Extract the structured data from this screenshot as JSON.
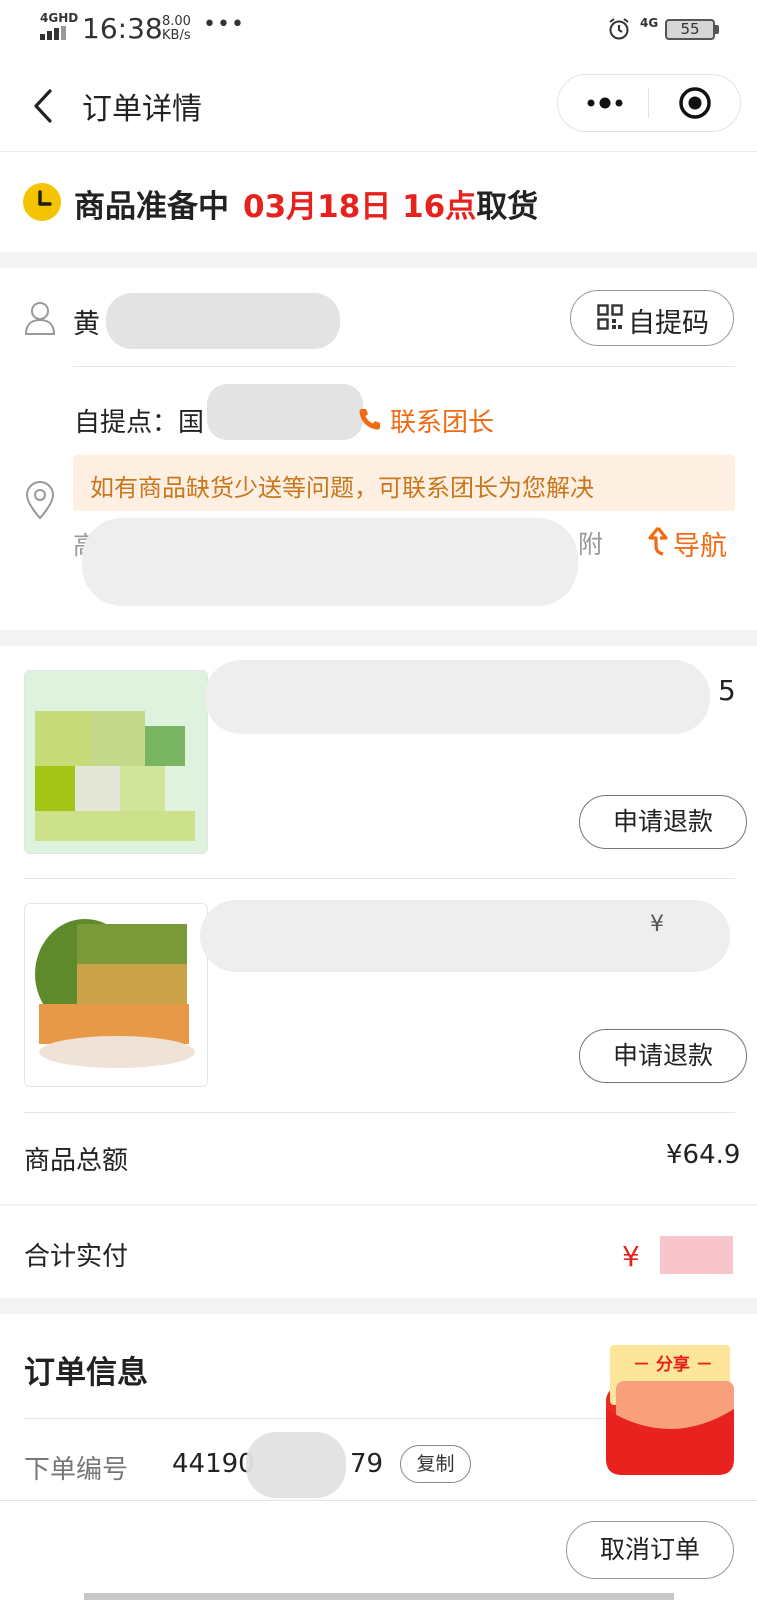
{
  "status_bar": {
    "network": "4GHD",
    "time": "16:38",
    "speed_value": "8.00",
    "speed_unit": "KB/s",
    "more": "•••",
    "net_right": "4G",
    "battery": "55"
  },
  "nav": {
    "title": "订单详情",
    "back_icon": "chevron-left-icon",
    "more_icon": "more-dots-icon",
    "close_icon": "target-icon"
  },
  "order_status": {
    "state": "商品准备中",
    "pickup_time": "03月18日 16点",
    "pickup_suffix": "取货",
    "icon": "clock-icon",
    "icon_color": "#f5c400"
  },
  "pickup": {
    "name_visible": "黄",
    "pickup_code_button": "自提码",
    "pickup_point_label": "自提点：国",
    "contact_leader": "联系团长",
    "tip": "如有商品缺货少送等问题，可联系团长为您解决",
    "address_visible": "高",
    "address_right_fragment": "附",
    "navigate": "导航",
    "accent_color": "#f16a14"
  },
  "products": [
    {
      "price_fragment": "5",
      "refund_button": "申请退款"
    },
    {
      "price_fragment": "¥",
      "refund_button": "申请退款"
    }
  ],
  "totals": {
    "goods_total_label": "商品总额",
    "goods_total_value": "¥64.9",
    "paid_label": "合计实付",
    "paid_value": "¥"
  },
  "order_info": {
    "title": "订单信息",
    "order_no_label": "下单编号",
    "order_no_start": "44190",
    "order_no_end": "79",
    "copy_button": "复制"
  },
  "share": {
    "label": "－ 分享 －"
  },
  "bottom": {
    "cancel_button": "取消订单"
  }
}
